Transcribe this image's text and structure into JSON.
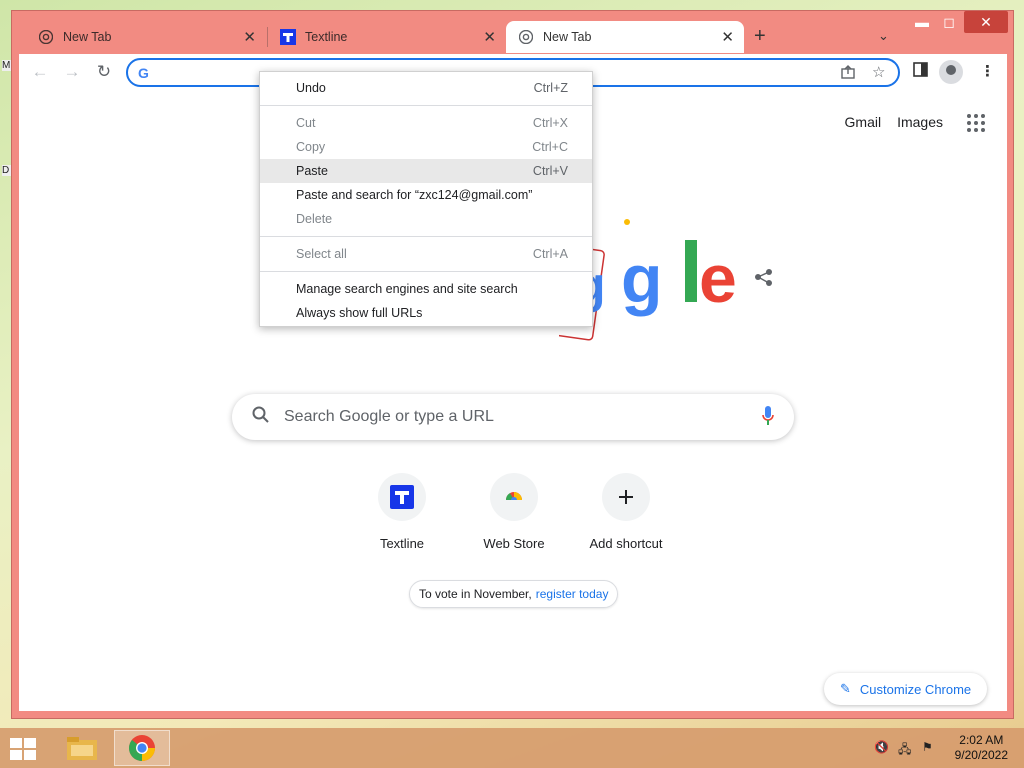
{
  "desktop": {
    "left_labels": [
      "M",
      "D"
    ]
  },
  "window": {
    "controls": {
      "minimize": "▬",
      "maximize": "◻",
      "close": "✕"
    },
    "tabs": [
      {
        "title": "New Tab",
        "favicon": "chrome-icon",
        "active": false
      },
      {
        "title": "Textline",
        "favicon": "textline-icon",
        "active": false
      },
      {
        "title": "New Tab",
        "favicon": "chrome-icon",
        "active": true
      }
    ],
    "new_tab_glyph": "+",
    "tab_search_glyph": "⌄"
  },
  "toolbar": {
    "back": "←",
    "forward": "→",
    "reload": "↻",
    "omnibox_value": "",
    "omnibox_g": "G"
  },
  "page": {
    "top_links": [
      "Gmail",
      "Images"
    ],
    "search_placeholder": "Search Google or type a URL",
    "shortcuts": [
      {
        "label": "Textline",
        "icon": "textline-icon"
      },
      {
        "label": "Web Store",
        "icon": "webstore-icon"
      },
      {
        "label": "Add shortcut",
        "icon": "plus-icon"
      }
    ],
    "promo_text": "To vote in November,",
    "promo_link": "register today",
    "customize_label": "Customize Chrome"
  },
  "context_menu": {
    "groups": [
      [
        {
          "label": "Undo",
          "shortcut": "Ctrl+Z",
          "disabled": false
        }
      ],
      [
        {
          "label": "Cut",
          "shortcut": "Ctrl+X",
          "disabled": true
        },
        {
          "label": "Copy",
          "shortcut": "Ctrl+C",
          "disabled": true
        },
        {
          "label": "Paste",
          "shortcut": "Ctrl+V",
          "disabled": false,
          "hover": true
        },
        {
          "label": "Paste and search for “zxc124@gmail.com”",
          "shortcut": "",
          "disabled": false
        },
        {
          "label": "Delete",
          "shortcut": "",
          "disabled": true
        }
      ],
      [
        {
          "label": "Select all",
          "shortcut": "Ctrl+A",
          "disabled": true
        }
      ],
      [
        {
          "label": "Manage search engines and site search",
          "shortcut": "",
          "disabled": false
        },
        {
          "label": "Always show full URLs",
          "shortcut": "",
          "disabled": false
        }
      ]
    ]
  },
  "taskbar": {
    "time": "2:02 AM",
    "date": "9/20/2022"
  },
  "colors": {
    "frame": "#f28b82",
    "accent": "#1a73e8"
  }
}
